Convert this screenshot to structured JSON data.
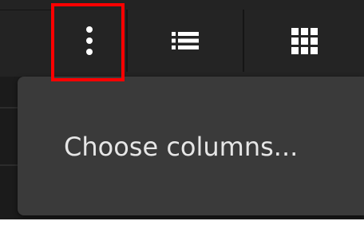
{
  "toolbar": {
    "buttons": [
      {
        "name": "more-options",
        "icon": "vertical-ellipsis-icon"
      },
      {
        "name": "list-view",
        "icon": "list-icon"
      },
      {
        "name": "grid-view",
        "icon": "grid-icon"
      }
    ],
    "highlighted_button": "more-options"
  },
  "menu": {
    "items": [
      {
        "label": "Choose columns..."
      }
    ]
  },
  "colors": {
    "highlight": "#ff0000",
    "icon": "#ffffff",
    "menu_bg": "#3a3a3a",
    "toolbar_bg": "#242424"
  }
}
